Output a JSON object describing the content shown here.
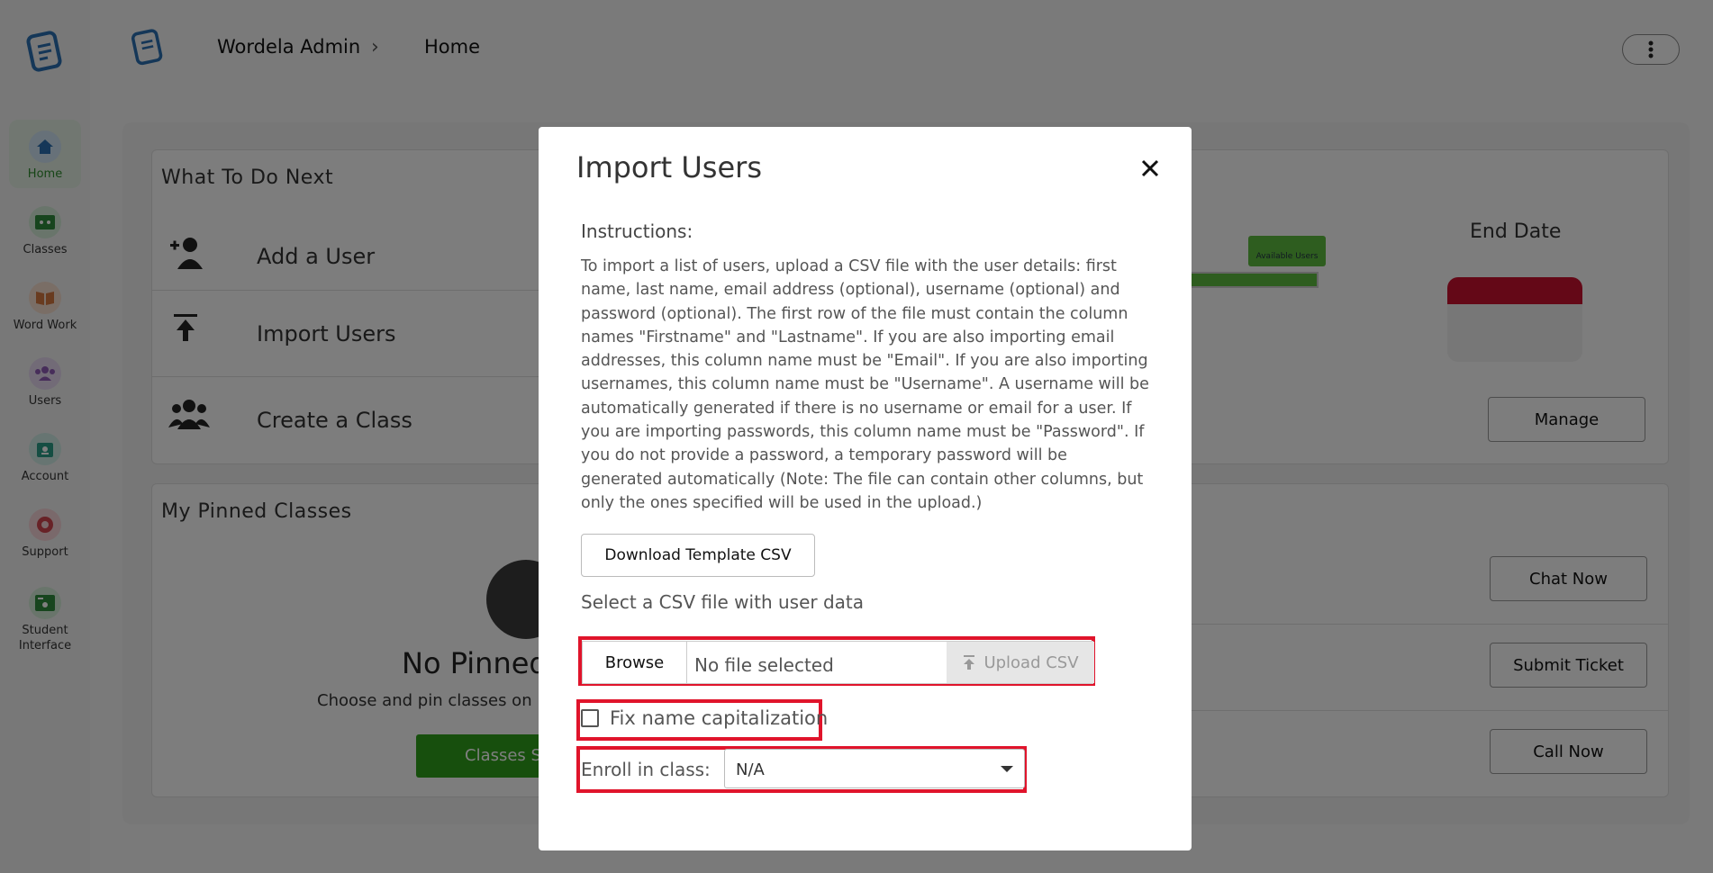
{
  "header": {
    "breadcrumb_root": "Wordela Admin",
    "breadcrumb_current": "Home"
  },
  "sidebar": {
    "items": [
      {
        "label": "Home",
        "icon": "home-icon"
      },
      {
        "label": "Classes",
        "icon": "classes-icon"
      },
      {
        "label": "Word Work",
        "icon": "book-icon"
      },
      {
        "label": "Users",
        "icon": "users-icon"
      },
      {
        "label": "Account",
        "icon": "account-icon"
      },
      {
        "label": "Support",
        "icon": "support-icon"
      },
      {
        "label": "Student Interface",
        "icon": "student-interface-icon"
      }
    ]
  },
  "todo": {
    "title": "What To Do Next",
    "items": [
      {
        "label": "Add a User",
        "icon": "add-user-icon"
      },
      {
        "label": "Import Users",
        "icon": "import-icon"
      },
      {
        "label": "Create a Class",
        "icon": "group-icon"
      }
    ]
  },
  "stats": {
    "end_date_label": "End Date",
    "available_users_badge": "Available Users",
    "manage_label": "Manage"
  },
  "pinned": {
    "title": "My Pinned Classes",
    "empty_title": "No Pinned",
    "empty_hint": "Choose and pin classes on",
    "classes_button": "Classes S"
  },
  "support": {
    "chat_label": "Chat Now",
    "ticket_label": "Submit Ticket",
    "call_label": "Call Now"
  },
  "modal": {
    "title": "Import Users",
    "instructions_heading": "Instructions:",
    "instructions_body": "To import a list of users, upload a CSV file with the user details: first name, last name, email address (optional), username (optional) and password (optional). The first row of the file must contain the column names \"Firstname\" and \"Lastname\". If you are also importing email addresses, this column name must be \"Email\". If you are also importing usernames, this column name must be \"Username\". A username will be automatically generated if there is no username or email for a user. If you are importing passwords, this column name must be \"Password\". If you do not provide a password, a temporary password will be generated automatically (Note: The file can contain other columns, but only the ones specified will be used in the upload.)",
    "template_button": "Download Template CSV",
    "select_label": "Select a CSV file with user data",
    "browse_button": "Browse",
    "file_status": "No file selected",
    "upload_button": "Upload CSV",
    "fix_caps_label": "Fix name capitalization",
    "fix_caps_checked": false,
    "enroll_label": "Enroll in class:",
    "enroll_value": "N/A"
  },
  "colors": {
    "accent_green": "#2e9e1a",
    "highlight_red": "#e0142b",
    "calendar_red": "#c8102e"
  }
}
